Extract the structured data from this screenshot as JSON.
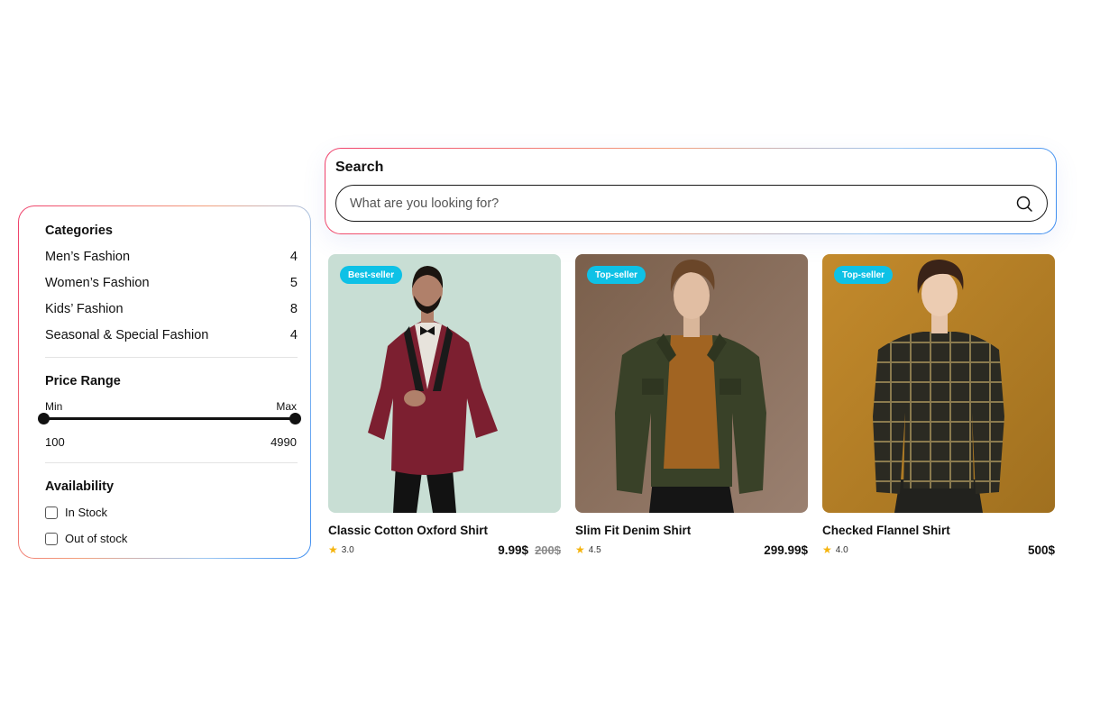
{
  "search": {
    "title": "Search",
    "placeholder": "What are you looking for?"
  },
  "filters": {
    "categories_title": "Categories",
    "categories": [
      {
        "label": "Men’s Fashion",
        "count": "4"
      },
      {
        "label": "Women’s Fashion",
        "count": "5"
      },
      {
        "label": "Kids’ Fashion",
        "count": "8"
      },
      {
        "label": "Seasonal & Special Fashion",
        "count": "4"
      }
    ],
    "price_title": "Price Range",
    "price_min_label": "Min",
    "price_max_label": "Max",
    "price_min_value": "100",
    "price_max_value": "4990",
    "availability_title": "Availability",
    "availability_options": [
      {
        "label": "In Stock",
        "checked": false
      },
      {
        "label": "Out of stock",
        "checked": false
      }
    ]
  },
  "products": [
    {
      "badge": "Best-seller",
      "name": "Classic Cotton Oxford Shirt",
      "rating": "3.0",
      "price": "9.99$",
      "old_price": "200$"
    },
    {
      "badge": "Top-seller",
      "name": "Slim Fit Denim Shirt",
      "rating": "4.5",
      "price": "299.99$",
      "old_price": ""
    },
    {
      "badge": "Top-seller",
      "name": "Checked Flannel Shirt",
      "rating": "4.0",
      "price": "500$",
      "old_price": ""
    }
  ],
  "colors": {
    "badge": "#0ec1e6",
    "star": "#f5b40d",
    "border_gradient_start": "#ef3f6b",
    "border_gradient_end": "#3d8df0"
  },
  "icons": {
    "search": "search-icon",
    "star": "star-icon"
  }
}
